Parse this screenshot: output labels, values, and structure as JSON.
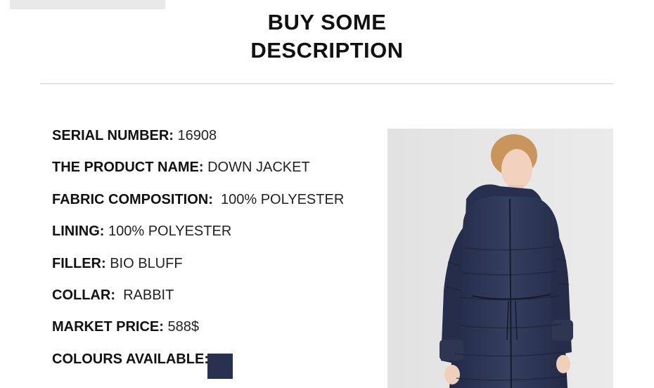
{
  "header": {
    "title_line1": "BUY SOME",
    "title_line2": "DESCRIPTION"
  },
  "specs": [
    {
      "label": "SERIAL NUMBER:",
      "value": " 16908"
    },
    {
      "label": "THE PRODUCT NAME:",
      "value": " DOWN JACKET"
    },
    {
      "label": "FABRIC COMPOSITION:",
      "value": "  100% POLYESTER"
    },
    {
      "label": "LINING:",
      "value": " 100% POLYESTER"
    },
    {
      "label": "FILLER:",
      "value": " BIO BLUFF"
    },
    {
      "label": "COLLAR:",
      "value": "  RABBIT"
    },
    {
      "label": "MARKET PRICE:",
      "value": " 588$"
    }
  ],
  "colours": {
    "label": "COLOURS AVAILABLE:",
    "swatches": [
      "#2a3150"
    ]
  },
  "photo": {
    "jacket_color": "#2b3252",
    "background": "#e6e6e6",
    "hair_color": "#c9955c"
  }
}
